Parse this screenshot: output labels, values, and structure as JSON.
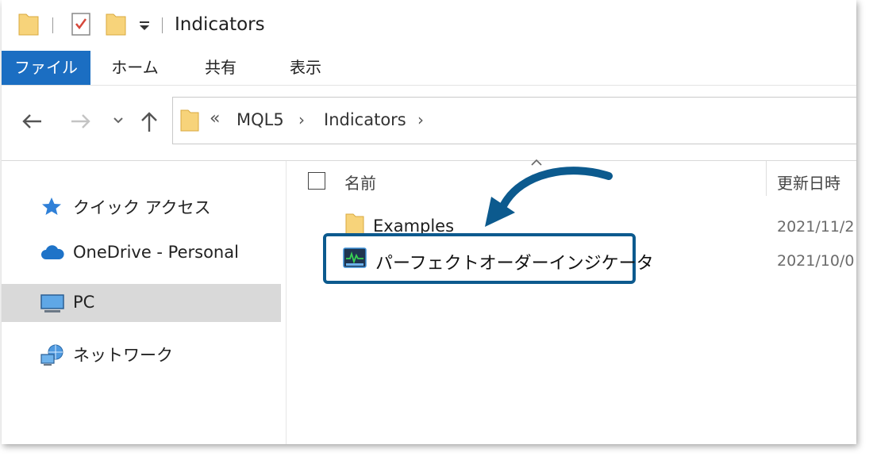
{
  "window": {
    "title": "Indicators"
  },
  "ribbon": {
    "tabs": [
      {
        "label": "ファイル",
        "active": true
      },
      {
        "label": "ホーム",
        "active": false
      },
      {
        "label": "共有",
        "active": false
      },
      {
        "label": "表示",
        "active": false
      }
    ]
  },
  "address": {
    "overflow_glyph": "«",
    "crumbs": [
      "MQL5",
      "Indicators"
    ],
    "separator": "›"
  },
  "sidebar": {
    "items": [
      {
        "label": "クイック アクセス",
        "icon": "star-icon"
      },
      {
        "label": "OneDrive - Personal",
        "icon": "cloud-icon"
      },
      {
        "label": "PC",
        "icon": "monitor-icon",
        "selected": true
      },
      {
        "label": "ネットワーク",
        "icon": "network-icon"
      }
    ]
  },
  "list": {
    "columns": {
      "name": "名前",
      "date": "更新日時"
    },
    "rows": [
      {
        "name": "Examples",
        "date": "2021/11/2",
        "icon": "folder-icon"
      },
      {
        "name": "パーフェクトオーダーインジケータ",
        "date": "2021/10/0",
        "icon": "indicator-file-icon",
        "highlighted": true
      }
    ]
  },
  "colors": {
    "accent": "#1b6ec2",
    "highlight_border": "#0c5a8e",
    "folder": "#f7d37a"
  }
}
